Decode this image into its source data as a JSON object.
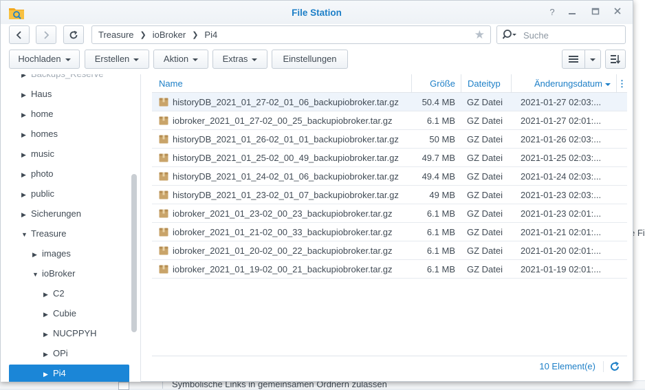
{
  "window": {
    "title": "File Station"
  },
  "address": {
    "breadcrumb": [
      "Treasure",
      "ioBroker",
      "Pi4"
    ],
    "search_placeholder": "Suche"
  },
  "toolbar": {
    "upload": "Hochladen",
    "create": "Erstellen",
    "action": "Aktion",
    "extras": "Extras",
    "settings": "Einstellungen"
  },
  "sidebar": {
    "items": [
      {
        "label": "Backups_Reserve",
        "indent": 0,
        "arrow": "right"
      },
      {
        "label": "Haus",
        "indent": 0,
        "arrow": "right"
      },
      {
        "label": "home",
        "indent": 0,
        "arrow": "right"
      },
      {
        "label": "homes",
        "indent": 0,
        "arrow": "right"
      },
      {
        "label": "music",
        "indent": 0,
        "arrow": "right"
      },
      {
        "label": "photo",
        "indent": 0,
        "arrow": "right"
      },
      {
        "label": "public",
        "indent": 0,
        "arrow": "right"
      },
      {
        "label": "Sicherungen",
        "indent": 0,
        "arrow": "right"
      },
      {
        "label": "Treasure",
        "indent": 0,
        "arrow": "down"
      },
      {
        "label": "images",
        "indent": 1,
        "arrow": "right"
      },
      {
        "label": "ioBroker",
        "indent": 1,
        "arrow": "down"
      },
      {
        "label": "C2",
        "indent": 2,
        "arrow": "right"
      },
      {
        "label": "Cubie",
        "indent": 2,
        "arrow": "right"
      },
      {
        "label": "NUCPPYH",
        "indent": 2,
        "arrow": "right"
      },
      {
        "label": "OPi",
        "indent": 2,
        "arrow": "right"
      },
      {
        "label": "Pi4",
        "indent": 2,
        "arrow": "right",
        "selected": true
      }
    ]
  },
  "list": {
    "columns": {
      "name": "Name",
      "size": "Größe",
      "type": "Dateityp",
      "modified": "Änderungsdatum"
    },
    "rows": [
      {
        "name": "historyDB_2021_01_27-02_01_06_backupiobroker.tar.gz",
        "size": "50.4 MB",
        "type": "GZ Datei",
        "modified": "2021-01-27 02:03:..."
      },
      {
        "name": "iobroker_2021_01_27-02_00_25_backupiobroker.tar.gz",
        "size": "6.1 MB",
        "type": "GZ Datei",
        "modified": "2021-01-27 02:01:..."
      },
      {
        "name": "historyDB_2021_01_26-02_01_01_backupiobroker.tar.gz",
        "size": "50 MB",
        "type": "GZ Datei",
        "modified": "2021-01-26 02:03:..."
      },
      {
        "name": "historyDB_2021_01_25-02_00_49_backupiobroker.tar.gz",
        "size": "49.7 MB",
        "type": "GZ Datei",
        "modified": "2021-01-25 02:03:..."
      },
      {
        "name": "historyDB_2021_01_24-02_01_06_backupiobroker.tar.gz",
        "size": "49.4 MB",
        "type": "GZ Datei",
        "modified": "2021-01-24 02:03:..."
      },
      {
        "name": "historyDB_2021_01_23-02_01_07_backupiobroker.tar.gz",
        "size": "49 MB",
        "type": "GZ Datei",
        "modified": "2021-01-23 02:03:..."
      },
      {
        "name": "iobroker_2021_01_23-02_00_23_backupiobroker.tar.gz",
        "size": "6.1 MB",
        "type": "GZ Datei",
        "modified": "2021-01-23 02:01:..."
      },
      {
        "name": "iobroker_2021_01_21-02_00_33_backupiobroker.tar.gz",
        "size": "6.1 MB",
        "type": "GZ Datei",
        "modified": "2021-01-21 02:01:..."
      },
      {
        "name": "iobroker_2021_01_20-02_00_22_backupiobroker.tar.gz",
        "size": "6.1 MB",
        "type": "GZ Datei",
        "modified": "2021-01-20 02:01:..."
      },
      {
        "name": "iobroker_2021_01_19-02_00_21_backupiobroker.tar.gz",
        "size": "6.1 MB",
        "type": "GZ Datei",
        "modified": "2021-01-19 02:01:..."
      }
    ]
  },
  "status": {
    "count": "10 Element(e)"
  },
  "background": {
    "right_text": "e Fi",
    "bottom_text": "Symbolische Links in gemeinsamen Ordnern zulassen"
  },
  "colors": {
    "accent": "#1d7fc7",
    "selected": "#1b86d7",
    "folder": "#c9a46a"
  }
}
